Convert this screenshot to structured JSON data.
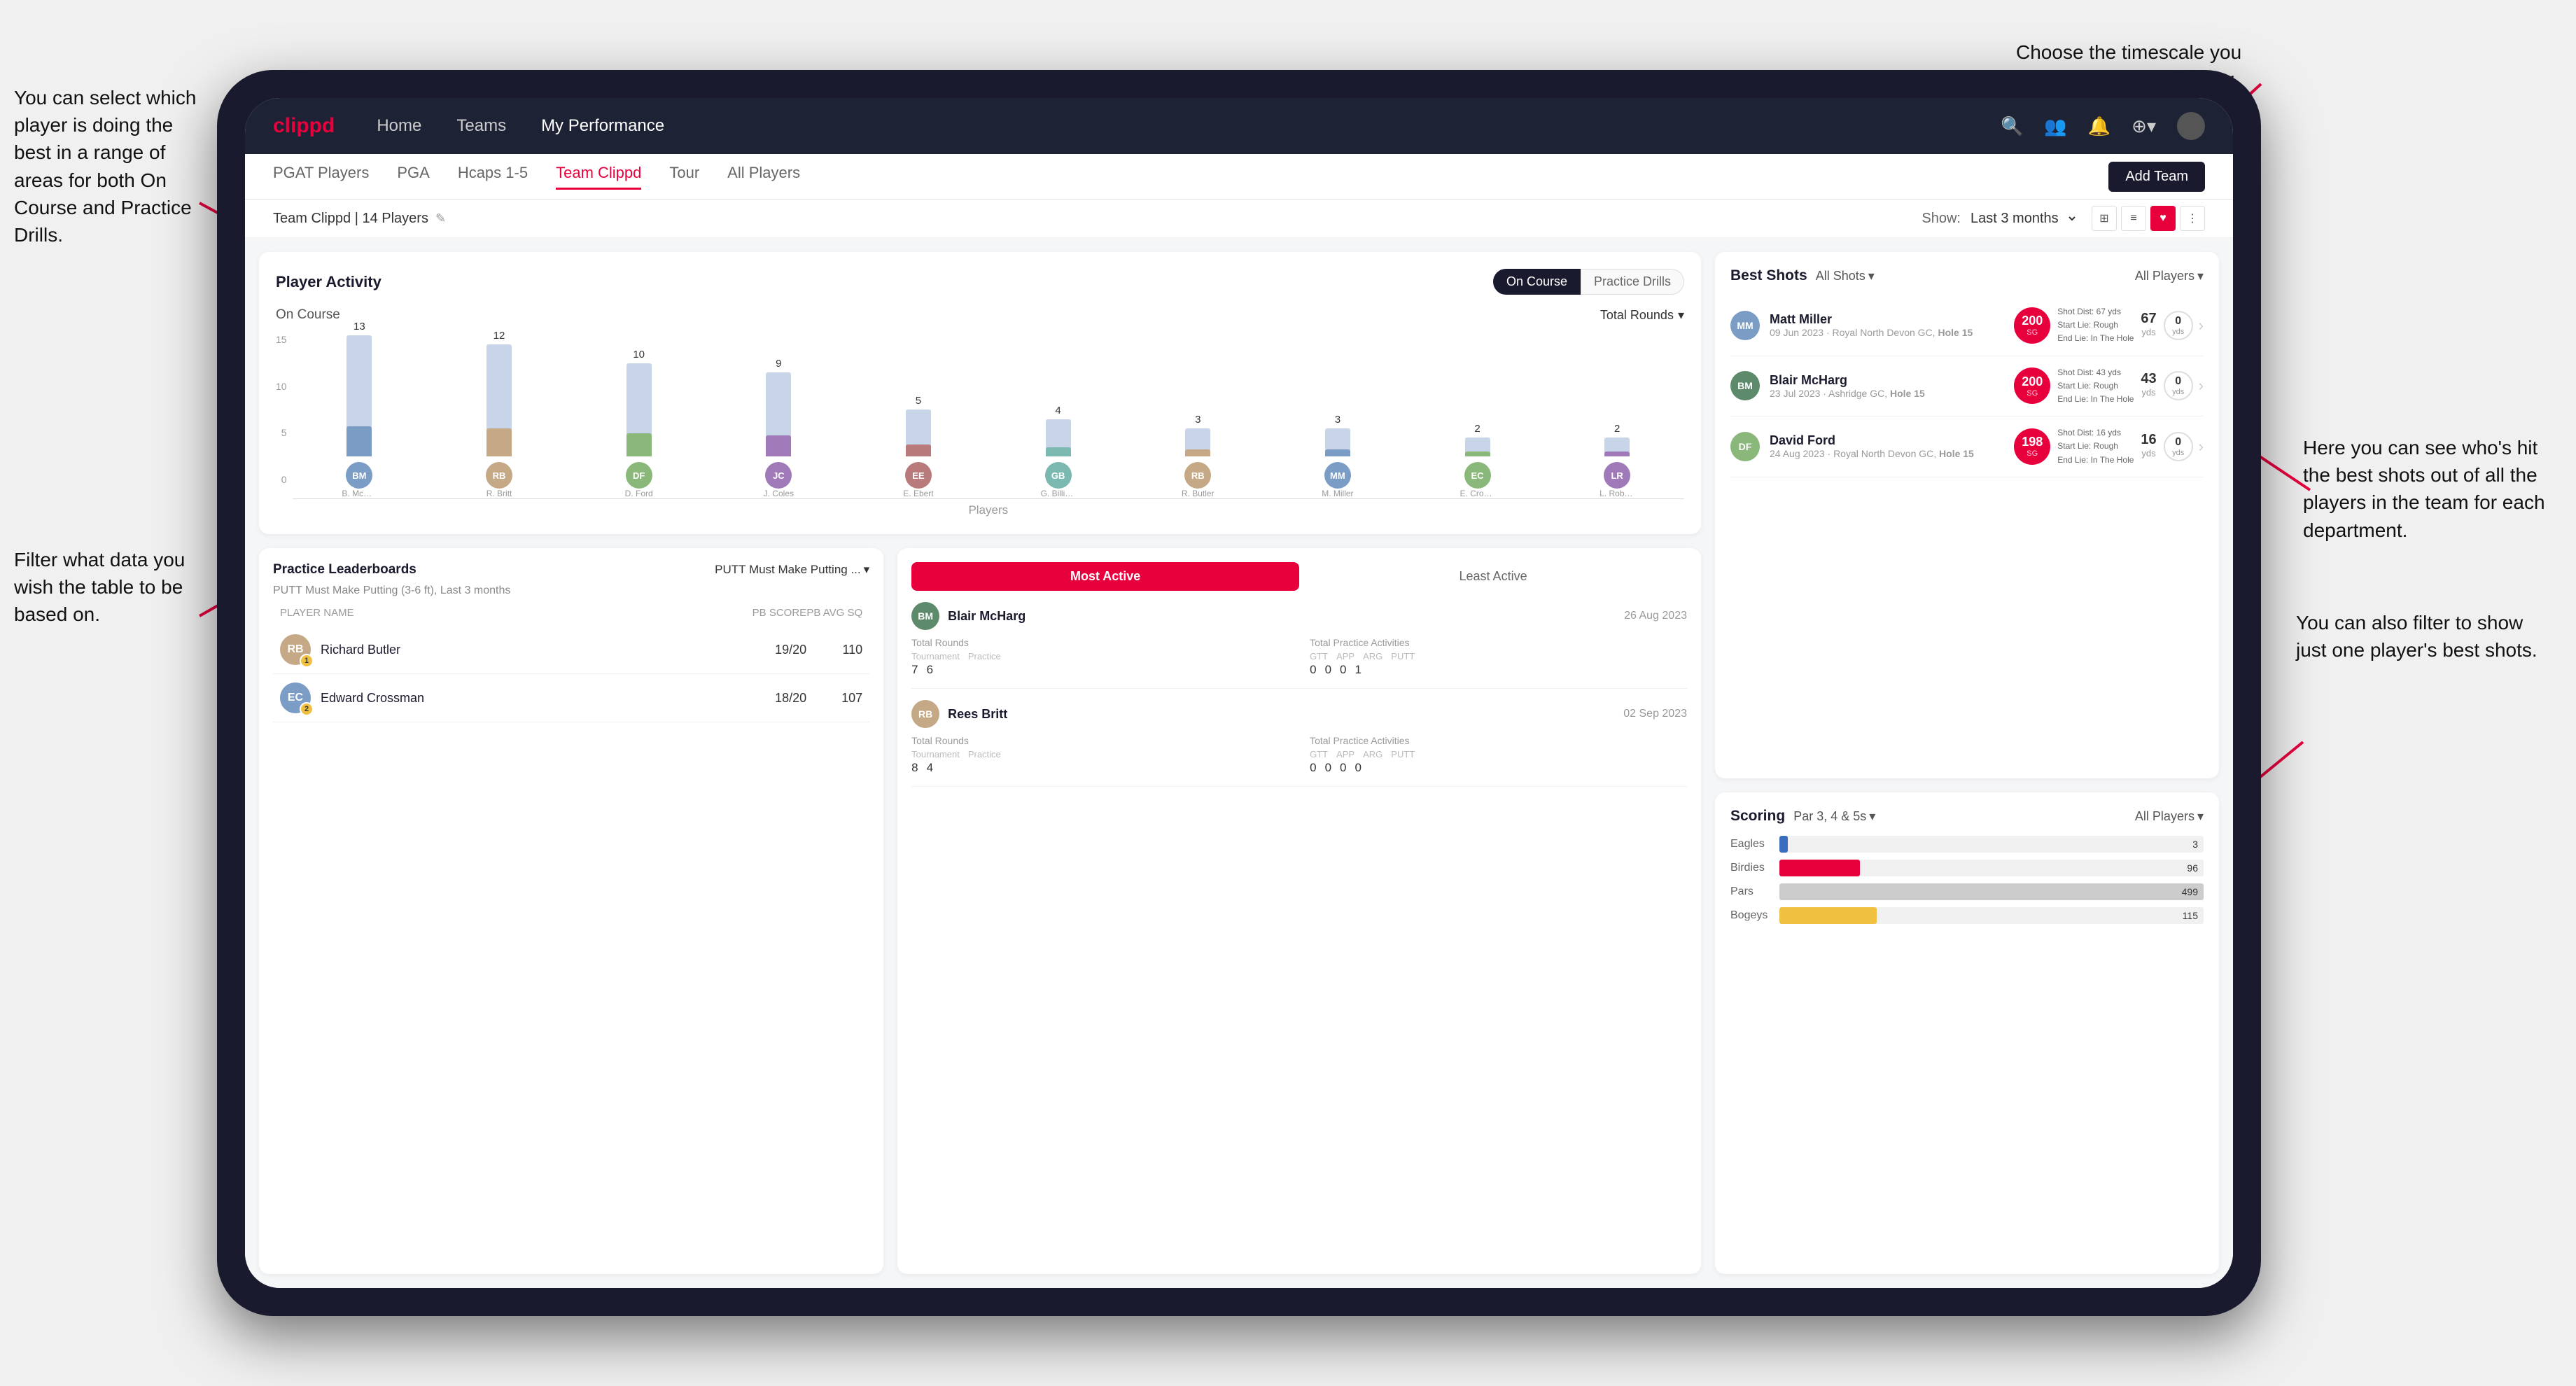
{
  "annotations": {
    "top_right": "Choose the timescale you\nwish to see the data over.",
    "top_left": "You can select which player is\ndoing the best in a range of\nareas for both On Course and\nPractice Drills.",
    "bottom_left": "Filter what data you wish the\ntable to be based on.",
    "right_1": "Here you can see who's hit\nthe best shots out of all the\nplayers in the team for\neach department.",
    "right_2": "You can also filter to show\njust one player's best shots."
  },
  "nav": {
    "logo": "clippd",
    "links": [
      "Home",
      "Teams",
      "My Performance"
    ],
    "icons": [
      "🔍",
      "👤",
      "🔔",
      "⊕",
      "👤"
    ]
  },
  "sub_nav": {
    "tabs": [
      "PGAT Players",
      "PGA",
      "Hcaps 1-5",
      "Team Clippd",
      "Tour",
      "All Players"
    ],
    "active_tab": "Team Clippd",
    "add_btn": "Add Team"
  },
  "team_header": {
    "team_name": "Team Clippd | 14 Players",
    "show_label": "Show:",
    "show_value": "Last 3 months",
    "view_icons": [
      "⊞",
      "⊟",
      "♥",
      "≡"
    ]
  },
  "player_activity": {
    "title": "Player Activity",
    "tabs": [
      "On Course",
      "Practice Drills"
    ],
    "active_tab": "On Course",
    "chart": {
      "subtitle": "On Course",
      "filter": "Total Rounds",
      "y_labels": [
        "0",
        "5",
        "10",
        "15"
      ],
      "x_label": "Players",
      "bars": [
        {
          "name": "B. McHarg",
          "value": 13,
          "initials": "BM",
          "color": "#7a9cc5"
        },
        {
          "name": "R. Britt",
          "value": 12,
          "initials": "RB",
          "color": "#c5a885"
        },
        {
          "name": "D. Ford",
          "value": 10,
          "initials": "DF",
          "color": "#8ab87a"
        },
        {
          "name": "J. Coles",
          "value": 9,
          "initials": "JC",
          "color": "#a07ab8"
        },
        {
          "name": "E. Ebert",
          "value": 5,
          "initials": "EE",
          "color": "#b87a7a"
        },
        {
          "name": "G. Billingham",
          "value": 4,
          "initials": "GB",
          "color": "#7ab8b0"
        },
        {
          "name": "R. Butler",
          "value": 3,
          "initials": "RB2",
          "color": "#c5a885"
        },
        {
          "name": "M. Miller",
          "value": 3,
          "initials": "MM",
          "color": "#7a9cc5"
        },
        {
          "name": "E. Crossman",
          "value": 2,
          "initials": "EC",
          "color": "#8ab87a"
        },
        {
          "name": "L. Robertson",
          "value": 2,
          "initials": "LR",
          "color": "#a07ab8"
        }
      ]
    }
  },
  "practice_leaderboards": {
    "title": "Practice Leaderboards",
    "drill_select": "PUTT Must Make Putting ...",
    "subtitle": "PUTT Must Make Putting (3-6 ft), Last 3 months",
    "cols": {
      "name": "PLAYER NAME",
      "pb": "PB SCORE",
      "avg": "PB AVG SQ"
    },
    "players": [
      {
        "name": "Richard Butler",
        "initials": "RB",
        "rank": 1,
        "pb": "19/20",
        "avg": "110",
        "avatar_color": "#c5a885"
      },
      {
        "name": "Edward Crossman",
        "initials": "EC",
        "rank": 2,
        "pb": "18/20",
        "avg": "107",
        "avatar_color": "#7a9cc5"
      }
    ]
  },
  "most_active": {
    "tabs": [
      "Most Active",
      "Least Active"
    ],
    "active_tab": "Most Active",
    "players": [
      {
        "name": "Blair McHarg",
        "initials": "BM",
        "date": "26 Aug 2023",
        "avatar_color": "#5c8a6b",
        "total_rounds_label": "Total Rounds",
        "tournament": "7",
        "practice": "6",
        "total_practice_label": "Total Practice Activities",
        "gtt": "0",
        "app": "0",
        "arg": "0",
        "putt": "1"
      },
      {
        "name": "Rees Britt",
        "initials": "RB",
        "date": "02 Sep 2023",
        "avatar_color": "#c5a885",
        "total_rounds_label": "Total Rounds",
        "tournament": "8",
        "practice": "4",
        "total_practice_label": "Total Practice Activities",
        "gtt": "0",
        "app": "0",
        "arg": "0",
        "putt": "0"
      }
    ]
  },
  "best_shots": {
    "title": "Best Shots",
    "filter": "All Shots",
    "players": "All Players",
    "shots": [
      {
        "player_name": "Matt Miller",
        "initials": "MM",
        "avatar_color": "#7a9cc5",
        "date": "09 Jun 2023 · Royal North Devon GC,",
        "hole": "Hole 15",
        "badge_num": "200",
        "badge_sub": "SG",
        "dist": "Shot Dist: 67 yds\nStart Lie: Rough\nEnd Lie: In The Hole",
        "metric1_val": "67",
        "metric1_unit": "yds",
        "metric2_val": "0",
        "metric2_unit": "yds"
      },
      {
        "player_name": "Blair McHarg",
        "initials": "BM",
        "avatar_color": "#5c8a6b",
        "date": "23 Jul 2023 · Ashridge GC,",
        "hole": "Hole 15",
        "badge_num": "200",
        "badge_sub": "SG",
        "dist": "Shot Dist: 43 yds\nStart Lie: Rough\nEnd Lie: In The Hole",
        "metric1_val": "43",
        "metric1_unit": "yds",
        "metric2_val": "0",
        "metric2_unit": "yds"
      },
      {
        "player_name": "David Ford",
        "initials": "DF",
        "avatar_color": "#8ab87a",
        "date": "24 Aug 2023 · Royal North Devon GC,",
        "hole": "Hole 15",
        "badge_num": "198",
        "badge_sub": "SG",
        "dist": "Shot Dist: 16 yds\nStart Lie: Rough\nEnd Lie: In The Hole",
        "metric1_val": "16",
        "metric1_unit": "yds",
        "metric2_val": "0",
        "metric2_unit": "yds"
      }
    ]
  },
  "scoring": {
    "title": "Scoring",
    "filter": "Par 3, 4 & 5s",
    "players": "All Players",
    "rows": [
      {
        "label": "Eagles",
        "value": 3,
        "max": 500,
        "color": "#3a6cbf"
      },
      {
        "label": "Birdies",
        "value": 96,
        "max": 500,
        "color": "#e8003d"
      },
      {
        "label": "Pars",
        "value": 499,
        "max": 500,
        "color": "#cccccc"
      },
      {
        "label": "Bogeys",
        "value": 115,
        "max": 500,
        "color": "#f0c040"
      }
    ]
  }
}
